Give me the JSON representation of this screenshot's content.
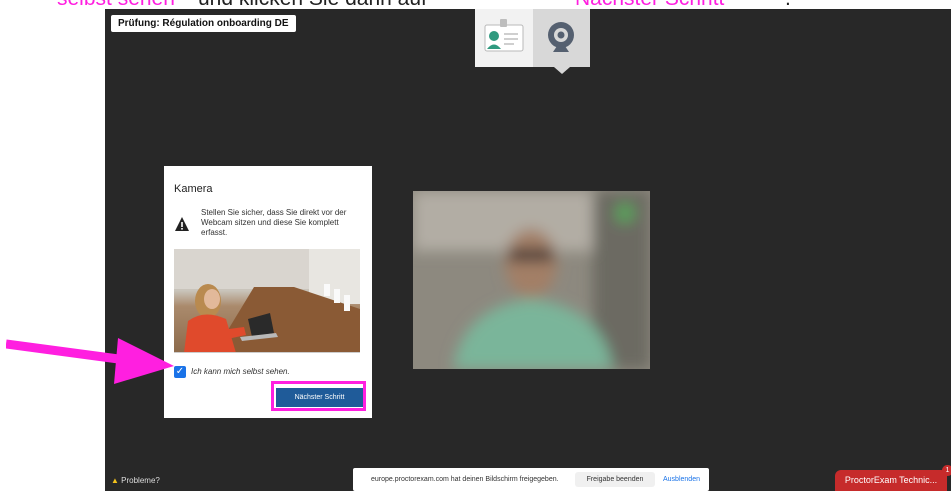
{
  "instruction": {
    "part1": "selbst sehen",
    "part2": " und klicken Sie dann auf ",
    "part3": "Nächster Schritt",
    "part4": "."
  },
  "exam": {
    "title": "Prüfung: Régulation onboarding DE"
  },
  "steps": [
    {
      "icon": "id-card-icon"
    },
    {
      "icon": "webcam-icon",
      "active": true
    }
  ],
  "camera_panel": {
    "title": "Kamera",
    "description": "Stellen Sie sicher, dass Sie direkt vor der Webcam sitzen und diese Sie komplett erfasst.",
    "checkbox_label": "Ich kann mich selbst sehen.",
    "checkbox_checked": true,
    "next_button": "Nächster Schritt"
  },
  "help": {
    "label": "Probleme?"
  },
  "share_bar": {
    "message": "europe.proctorexam.com hat deinen Bildschirm freigegeben.",
    "stop_label": "Freigabe beenden",
    "hide_label": "Ausblenden"
  },
  "support": {
    "label": "ProctorExam Technic...",
    "badge": "1"
  },
  "colors": {
    "highlight": "#ff1fe0",
    "background": "#282828",
    "button": "#1f5b99",
    "support": "#c62b2b"
  }
}
